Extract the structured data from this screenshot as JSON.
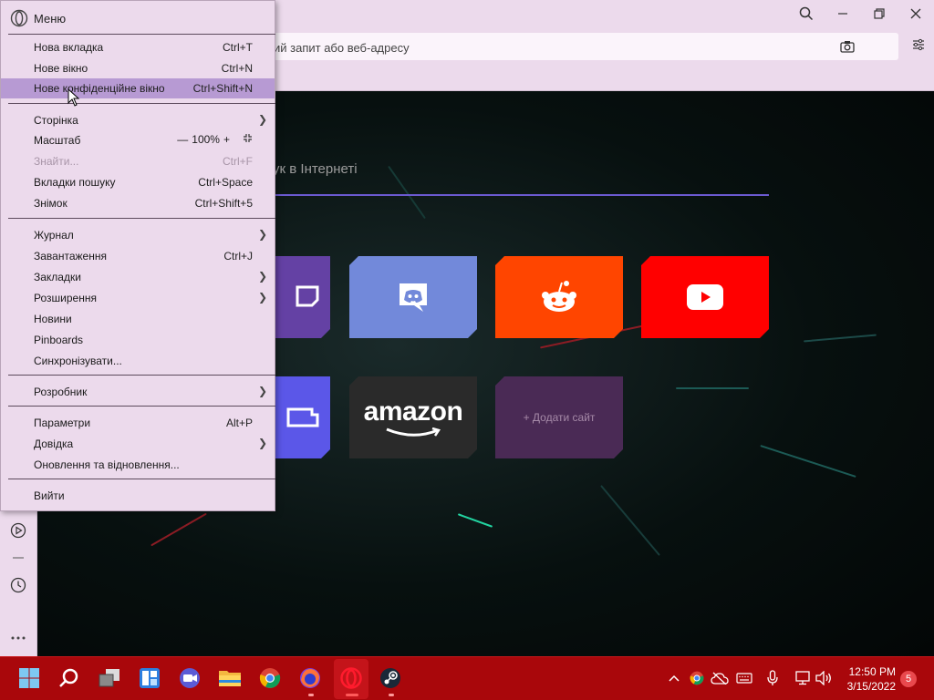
{
  "address_bar": {
    "placeholder_visible": "ий запит або веб-адресу"
  },
  "speed_dial": {
    "search_label": "шук в Інтернеті",
    "tiles": [
      {
        "name": "twitch",
        "color": "#6441a4"
      },
      {
        "name": "discord",
        "color": "#7289da"
      },
      {
        "name": "reddit",
        "color": "#ff4500"
      },
      {
        "name": "youtube",
        "color": "#ff0000"
      },
      {
        "name": "unknown",
        "color": "#5b57e8"
      },
      {
        "name": "amazon",
        "label": "amazon",
        "color": "#2a2a2a"
      },
      {
        "name": "add-site",
        "label": "+ Додати сайт",
        "color": "#4a2a55"
      }
    ]
  },
  "menu": {
    "title": "Меню",
    "items": [
      {
        "label": "Нова вкладка",
        "shortcut": "Ctrl+T"
      },
      {
        "label": "Нове вікно",
        "shortcut": "Ctrl+N"
      },
      {
        "label": "Нове конфіденційне вікно",
        "shortcut": "Ctrl+Shift+N",
        "highlighted": true
      },
      {
        "label": "Сторінка",
        "submenu": true
      },
      {
        "label": "Масштаб",
        "zoom": "100%"
      },
      {
        "label": "Знайти...",
        "shortcut": "Ctrl+F",
        "disabled": true
      },
      {
        "label": "Вкладки пошуку",
        "shortcut": "Ctrl+Space"
      },
      {
        "label": "Знімок",
        "shortcut": "Ctrl+Shift+5"
      },
      {
        "label": "Журнал",
        "submenu": true
      },
      {
        "label": "Завантаження",
        "shortcut": "Ctrl+J"
      },
      {
        "label": "Закладки",
        "submenu": true
      },
      {
        "label": "Розширення",
        "submenu": true
      },
      {
        "label": "Новини"
      },
      {
        "label": "Pinboards"
      },
      {
        "label": "Синхронізувати..."
      },
      {
        "label": "Розробник",
        "submenu": true
      },
      {
        "label": "Параметри",
        "shortcut": "Alt+P"
      },
      {
        "label": "Довідка",
        "submenu": true
      },
      {
        "label": "Оновлення та відновлення..."
      },
      {
        "label": "Вийти"
      }
    ],
    "zoom_minus": "—",
    "zoom_plus": "+"
  },
  "taskbar": {
    "apps": [
      "windows-start",
      "search",
      "task-view",
      "widgets",
      "zoom",
      "file-explorer",
      "chrome",
      "firefox",
      "opera",
      "steam"
    ],
    "time": "12:50 PM",
    "date": "3/15/2022",
    "notifications": "5"
  },
  "colors": {
    "chrome": "#ecdaec",
    "taskbar": "#a9070b",
    "menu_highlight": "#b79ad3",
    "search_underline": "#6b5ad0"
  }
}
